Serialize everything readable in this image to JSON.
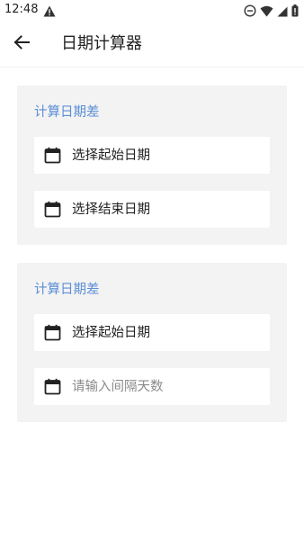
{
  "status_bar": {
    "time": "12:48",
    "icons": [
      "warning-icon",
      "do-not-disturb-icon",
      "wifi-icon",
      "signal-icon",
      "battery-icon"
    ]
  },
  "app_bar": {
    "back_icon": "arrow-left-icon",
    "title": "日期计算器"
  },
  "cards": [
    {
      "title": "计算日期差",
      "fields": [
        {
          "icon": "calendar-icon",
          "label": "选择起始日期"
        },
        {
          "icon": "calendar-icon",
          "label": "选择结束日期"
        }
      ]
    },
    {
      "title": "计算日期差",
      "fields": [
        {
          "icon": "calendar-icon",
          "label": "选择起始日期"
        },
        {
          "icon": "calendar-icon",
          "value": "",
          "placeholder": "请输入间隔天数"
        }
      ]
    }
  ],
  "colors": {
    "accent": "#5b8fd6",
    "card_background": "#f3f3f3",
    "field_background": "#ffffff",
    "text": "#222222",
    "placeholder": "#8a8a8a"
  }
}
